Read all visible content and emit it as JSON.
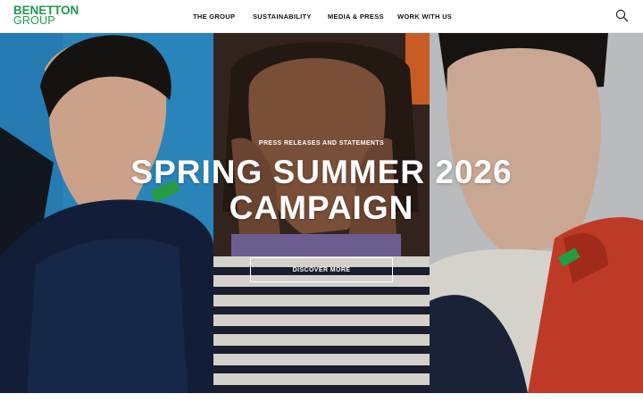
{
  "brand": {
    "line1": "BENETTON",
    "line2": "GROUP",
    "color": "#1f9b4b"
  },
  "nav": {
    "items": [
      {
        "label": "THE GROUP"
      },
      {
        "label": "SUSTAINABILITY"
      },
      {
        "label": "MEDIA & PRESS"
      },
      {
        "label": "WORK WITH US"
      }
    ]
  },
  "search": {
    "icon": "search-icon"
  },
  "hero": {
    "eyebrow": "PRESS RELEASES AND STATEMENTS",
    "title_line1": "SPRING SUMMER 2026",
    "title_line2": "CAMPAIGN",
    "cta": "DISCOVER MORE"
  }
}
